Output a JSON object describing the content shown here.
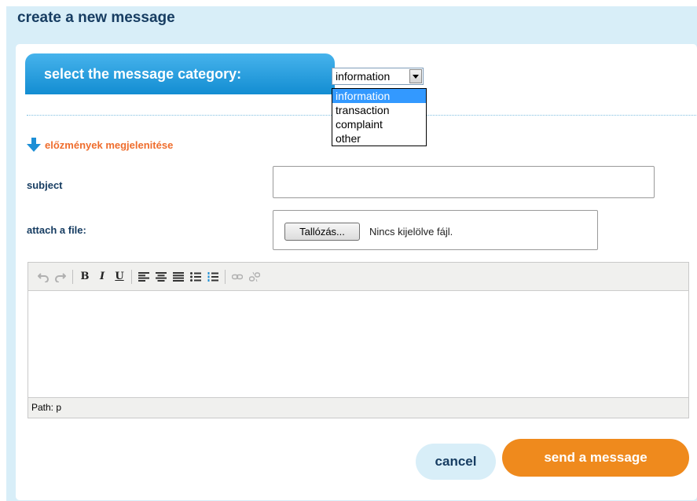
{
  "header": {
    "title": "create a new message"
  },
  "category": {
    "tab_label": "select the message category:",
    "selected": "information",
    "options": [
      "information",
      "transaction",
      "complaint",
      "other"
    ]
  },
  "history_link": "előzmények megjelenitése",
  "form": {
    "subject_label": "subject",
    "subject_value": "",
    "attach_label": "attach a file:",
    "browse_label": "Tallózás...",
    "no_file_text": "Nincs kijelölve fájl."
  },
  "editor": {
    "toolbar": {
      "bold": "B",
      "italic": "I",
      "underline": "U"
    },
    "status_path": "Path: p"
  },
  "buttons": {
    "cancel": "cancel",
    "send": "send a message"
  },
  "colors": {
    "accent_blue": "#138dd2",
    "accent_orange": "#ef8a1d",
    "link_orange": "#ef6d2d",
    "heading_navy": "#173d62"
  }
}
